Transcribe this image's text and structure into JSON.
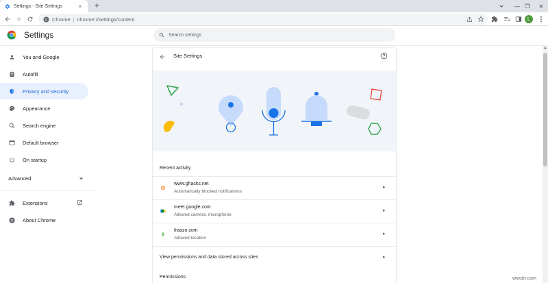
{
  "browser": {
    "tab_title": "Settings - Site Settings",
    "tab_close": "×",
    "new_tab": "+",
    "omnibox_site": "Chrome",
    "omnibox_sep": "|",
    "omnibox_url": "chrome://settings/content",
    "profile_initial": "L",
    "window_controls": [
      "—",
      "❐",
      "✕"
    ]
  },
  "header": {
    "title": "Settings",
    "search_placeholder": "Search settings"
  },
  "sidebar": {
    "items": [
      {
        "label": "You and Google",
        "icon": "person-icon"
      },
      {
        "label": "Autofill",
        "icon": "clipboard-icon"
      },
      {
        "label": "Privacy and security",
        "icon": "shield-icon",
        "active": true
      },
      {
        "label": "Appearance",
        "icon": "palette-icon"
      },
      {
        "label": "Search engine",
        "icon": "search-icon"
      },
      {
        "label": "Default browser",
        "icon": "browser-icon"
      },
      {
        "label": "On startup",
        "icon": "power-icon"
      }
    ],
    "advanced_label": "Advanced",
    "extensions_label": "Extensions",
    "about_label": "About Chrome"
  },
  "site_settings": {
    "title": "Site Settings",
    "recent_activity_title": "Recent activity",
    "recent": [
      {
        "site": "www.ghacks.net",
        "desc": "Automatically blocked notifications"
      },
      {
        "site": "meet.google.com",
        "desc": "Allowed camera, microphone"
      },
      {
        "site": "fraazo.com",
        "desc": "Allowed location"
      }
    ],
    "view_permissions_label": "View permissions and data stored across sites",
    "permissions_title": "Permissions"
  },
  "watermark": "wsxdn.com",
  "colors": {
    "accent": "#1a73e8",
    "active_bg": "#e8f0fe",
    "hero_bg": "#f1f4f9"
  }
}
